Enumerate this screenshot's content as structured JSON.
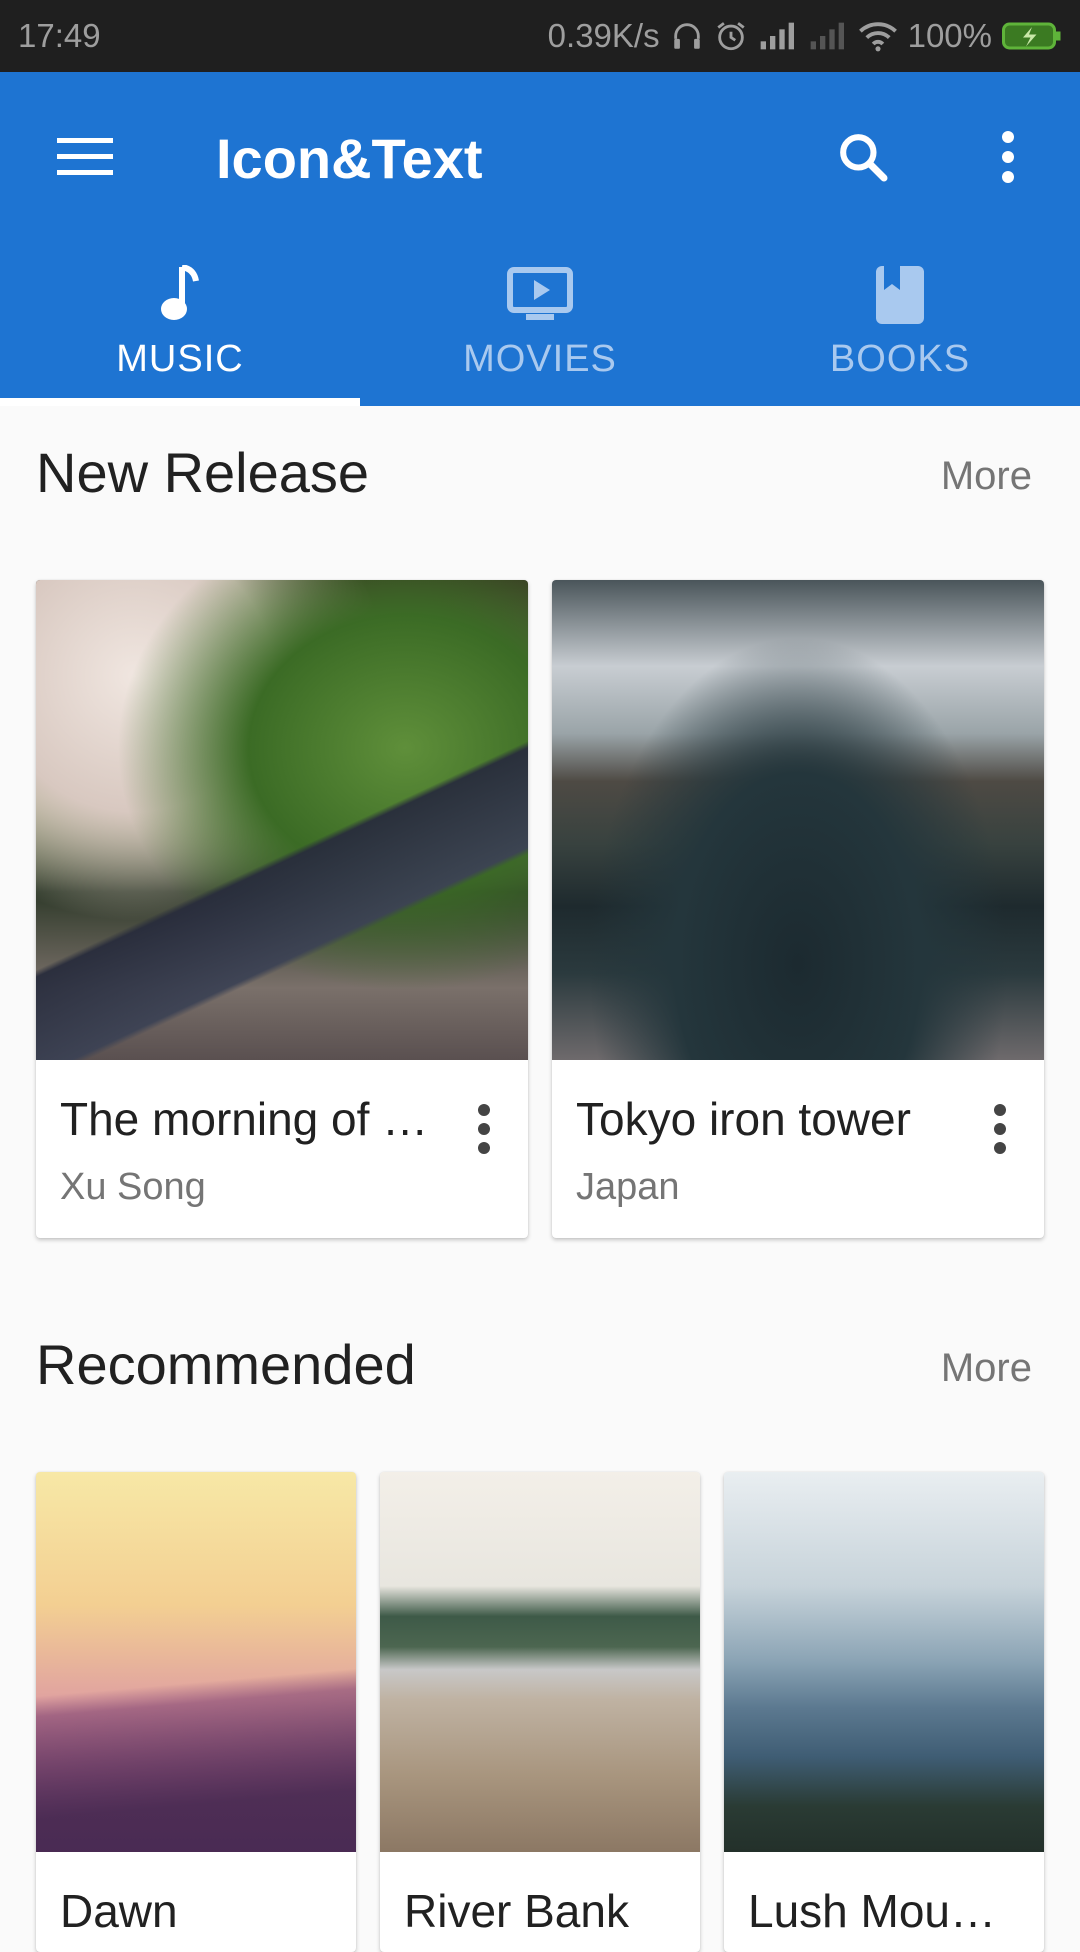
{
  "status_bar": {
    "time": "17:49",
    "net_speed": "0.39K/s",
    "battery": "100%",
    "icons": [
      "headphone-icon",
      "alarm-icon",
      "signal-icon",
      "signal-weak-icon",
      "wifi-icon",
      "battery-charging-icon"
    ]
  },
  "toolbar": {
    "title": "Icon&Text",
    "menu_icon": "hamburger-menu-icon",
    "search_icon": "search-icon",
    "overflow_icon": "more-vert-icon"
  },
  "tabs": [
    {
      "label": "MUSIC",
      "icon": "music-note-icon",
      "active": true
    },
    {
      "label": "MOVIES",
      "icon": "tv-play-icon",
      "active": false
    },
    {
      "label": "BOOKS",
      "icon": "book-icon",
      "active": false
    }
  ],
  "colors": {
    "primary": "#1e74d2",
    "status_bar": "#1f1f1f",
    "background": "#fafafa",
    "tab_inactive": "#a9c9ef",
    "text_secondary": "#757575"
  },
  "sections": {
    "new_release": {
      "title": "New Release",
      "more": "More",
      "cards": [
        {
          "title": "The morning of …",
          "subtitle": "Xu Song"
        },
        {
          "title": "Tokyo iron tower",
          "subtitle": "Japan"
        }
      ]
    },
    "recommended": {
      "title": "Recommended",
      "more": "More",
      "cards": [
        {
          "title": "Dawn"
        },
        {
          "title": "River Bank"
        },
        {
          "title": "Lush Mou…"
        }
      ]
    }
  }
}
